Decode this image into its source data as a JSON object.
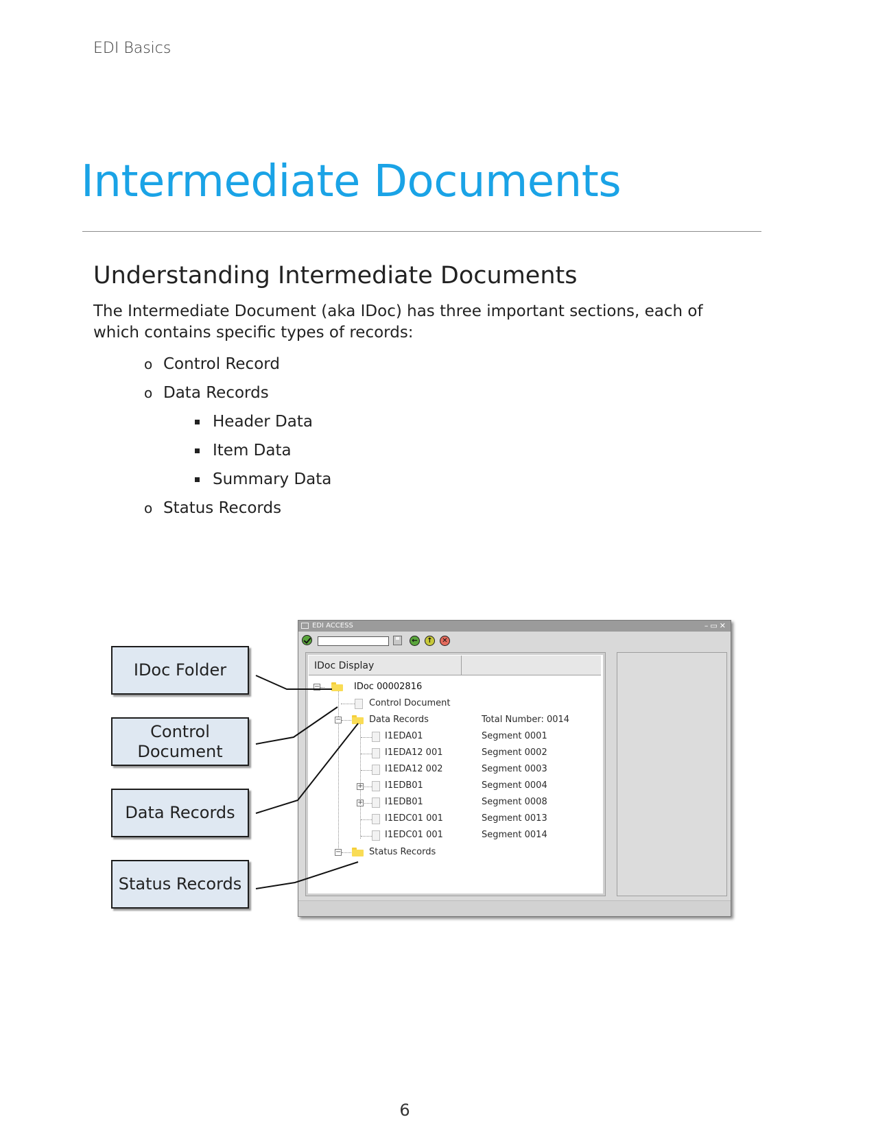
{
  "page": {
    "running_header": "EDI Basics",
    "title": "Intermediate Documents",
    "section_heading": "Understanding Intermediate Documents",
    "intro": "The Intermediate Document (aka IDoc) has three important sections, each of which contains specific types of records:",
    "bullets": [
      {
        "label": "Control Record",
        "children": []
      },
      {
        "label": "Data Records",
        "children": [
          "Header Data",
          "Item Data",
          "Summary Data"
        ]
      },
      {
        "label": "Status Records",
        "children": []
      }
    ],
    "bullet_marker": "o",
    "page_number": "6"
  },
  "callouts": [
    "IDoc Folder",
    "Control Document",
    "Data Records",
    "Status Records"
  ],
  "window": {
    "title": "EDI ACCESS",
    "controls": "–▭✕",
    "toolbar": {
      "ok_icon": "checkmark-icon",
      "command_field_value": "",
      "save_icon": "floppy-disk-icon",
      "back_icon": "arrow-left-icon",
      "up_icon": "arrow-up-icon",
      "cancel_icon": "cancel-icon",
      "back_glyph": "←",
      "up_glyph": "↑",
      "cancel_glyph": "✕"
    },
    "pane_header": "IDoc Display",
    "tree": {
      "root": "IDoc 00002816",
      "control": "Control Document",
      "data_records": {
        "label": "Data Records",
        "value": "Total Number: 0014"
      },
      "segments": [
        {
          "label": "I1EDA01",
          "value": "Segment 0001",
          "expandable": false
        },
        {
          "label": "I1EDA12 001",
          "value": "Segment 0002",
          "expandable": false
        },
        {
          "label": "I1EDA12 002",
          "value": "Segment 0003",
          "expandable": false
        },
        {
          "label": "I1EDB01",
          "value": "Segment 0004",
          "expandable": true
        },
        {
          "label": "I1EDB01",
          "value": "Segment 0008",
          "expandable": true
        },
        {
          "label": "I1EDC01 001",
          "value": "Segment 0013",
          "expandable": false
        },
        {
          "label": "I1EDC01 001",
          "value": "Segment 0014",
          "expandable": false
        }
      ],
      "status_records": "Status Records",
      "collapse_glyph": "−",
      "expand_glyph": "+"
    },
    "colors": {
      "titlebar": "#9b9b9b",
      "folder": "#f9dc55"
    }
  },
  "colors": {
    "title": "#1aa3e6",
    "callout_fill": "#dfe8f2"
  }
}
